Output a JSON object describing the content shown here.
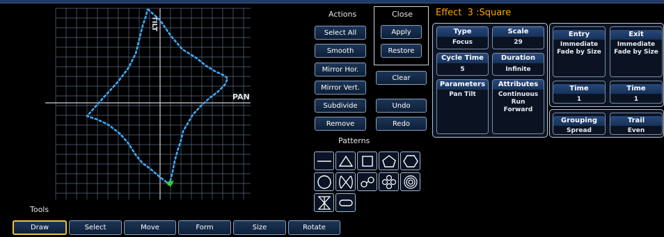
{
  "canvas": {
    "tilt_label": "TILT",
    "pan_label": "PAN"
  },
  "actions": {
    "heading": "Actions",
    "buttons": [
      "Select All",
      "Smooth",
      "Mirror Hor.",
      "Mirror Vert.",
      "Subdivide",
      "Remove"
    ]
  },
  "close": {
    "heading": "Close",
    "apply": "Apply",
    "restore": "Restore",
    "clear": "Clear",
    "undo": "Undo",
    "redo": "Redo"
  },
  "patterns": {
    "heading": "Patterns",
    "items": [
      "line",
      "triangle",
      "square",
      "pentagon",
      "hexagon",
      "circle",
      "figure-eight",
      "bow-tie",
      "four-leaf",
      "spiral",
      "hourglass",
      "infinity"
    ]
  },
  "effect": {
    "title": "Effect  3 :Square",
    "type": {
      "label": "Type",
      "value": "Focus"
    },
    "scale": {
      "label": "Scale",
      "value": "29"
    },
    "cycle_time": {
      "label": "Cycle Time",
      "value": "5"
    },
    "duration": {
      "label": "Duration",
      "value": "Infinite"
    },
    "parameters": {
      "label": "Parameters",
      "value": "Pan Tilt"
    },
    "attributes": {
      "label": "Attributes",
      "value_line1": "Continuous",
      "value_line2": "Run",
      "value_line3": "Forward"
    },
    "entry": {
      "label": "Entry",
      "line1": "Immediate",
      "line2": "Fade by Size"
    },
    "exit": {
      "label": "Exit",
      "line1": "Immediate",
      "line2": "Fade by Size"
    },
    "entry_time": {
      "label": "Time",
      "value": "1"
    },
    "exit_time": {
      "label": "Time",
      "value": "1"
    },
    "grouping": {
      "label": "Grouping",
      "value": "Spread"
    },
    "trail": {
      "label": "Trail",
      "value": "Even"
    }
  },
  "tools": {
    "heading": "Tools",
    "items": [
      "Draw",
      "Select",
      "Move",
      "Form",
      "Size",
      "Rotate"
    ],
    "active": "Draw"
  },
  "colors": {
    "accent": "#ffa500",
    "path": "#3fa9f5",
    "start_marker": "#30d040",
    "header": "#1f3a66"
  }
}
